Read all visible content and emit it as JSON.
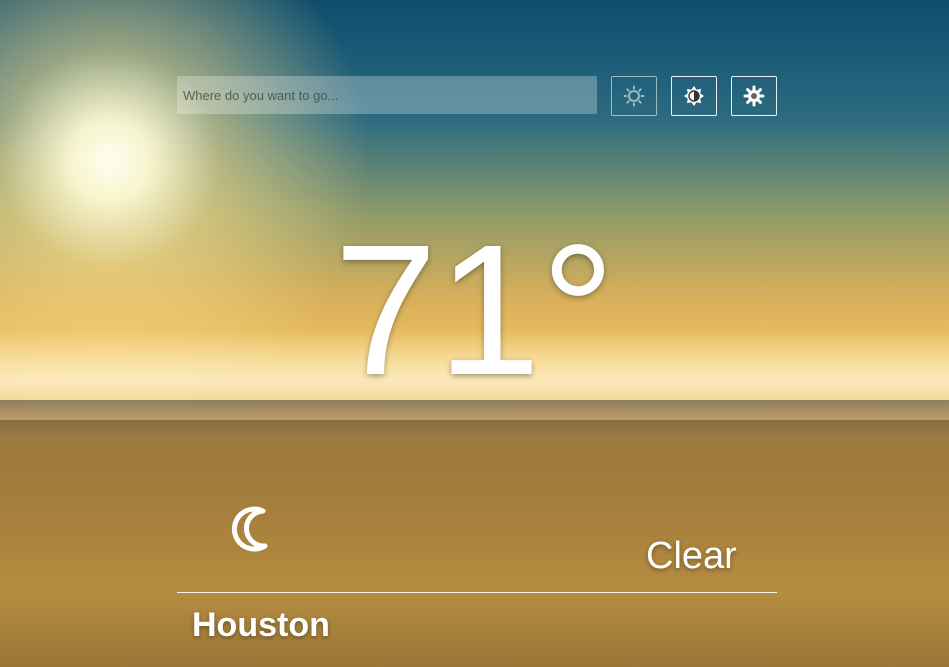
{
  "search": {
    "placeholder": "Where do you want to go..."
  },
  "toolbar": {
    "buttons": [
      {
        "icon": "sun-icon",
        "state": "dim"
      },
      {
        "icon": "contrast-icon",
        "state": "active"
      },
      {
        "icon": "gear-icon",
        "state": "active"
      }
    ]
  },
  "weather": {
    "temperature": "71°",
    "condition": "Clear",
    "condition_icon": "moon-icon",
    "city": "Houston"
  },
  "colors": {
    "text": "#ffffff",
    "sky_top": "#0e4d6e",
    "sunlight": "#f3c866"
  }
}
